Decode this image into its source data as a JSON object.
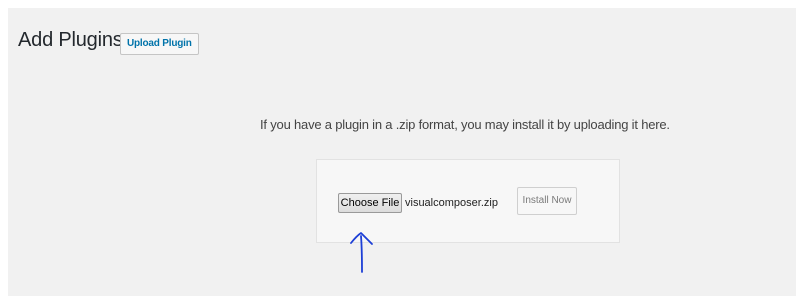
{
  "page": {
    "title": "Add Plugins",
    "upload_button_label": "Upload Plugin"
  },
  "upload_section": {
    "help_text": "If you have a plugin in a .zip format, you may install it by uploading it here.",
    "choose_file_label": "Choose File",
    "selected_file": "visualcomposer.zip",
    "install_button_label": "Install Now"
  },
  "annotation": {
    "icon": "hand-drawn-up-arrow-icon",
    "color": "#1d3fd6"
  }
}
